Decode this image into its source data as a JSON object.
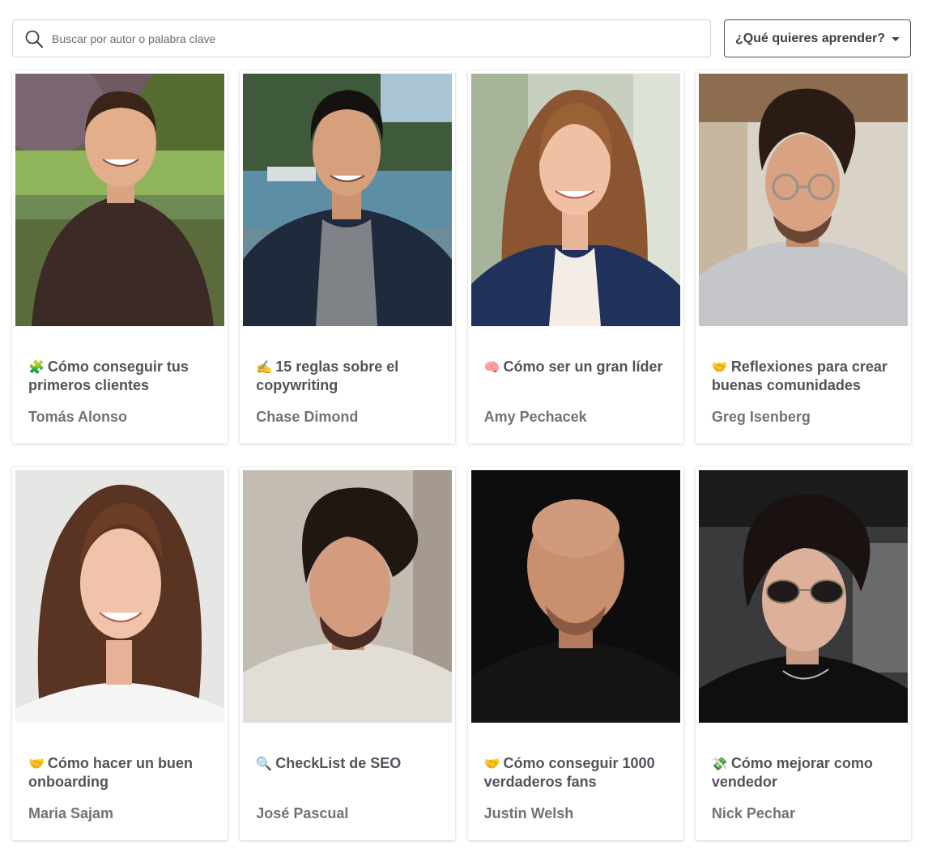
{
  "search": {
    "placeholder": "Buscar por autor o palabra clave",
    "icon": "search-icon"
  },
  "filter": {
    "label": "¿Qué quieres aprender?",
    "icon": "caret-down-icon"
  },
  "cards": [
    {
      "emoji": "🧩",
      "title": "Cómo conseguir tus primeros clientes",
      "author": "Tomás Alonso"
    },
    {
      "emoji": "✍️",
      "title": "15 reglas sobre el copywriting",
      "author": "Chase Dimond"
    },
    {
      "emoji": "🧠",
      "title": "Cómo ser un gran líder",
      "author": "Amy Pechacek"
    },
    {
      "emoji": "🤝",
      "title": "Reflexiones para crear buenas comunidades",
      "author": "Greg Isenberg"
    },
    {
      "emoji": "🤝",
      "title": "Cómo hacer un buen onboarding",
      "author": "Maria Sajam"
    },
    {
      "emoji": "🔍",
      "title": "CheckList de SEO",
      "author": "José Pascual"
    },
    {
      "emoji": "🤝",
      "title": "Cómo conseguir 1000 verdaderos fans",
      "author": "Justin Welsh"
    },
    {
      "emoji": "💸",
      "title": "Cómo mejorar como vendedor",
      "author": "Nick Pechar"
    }
  ]
}
